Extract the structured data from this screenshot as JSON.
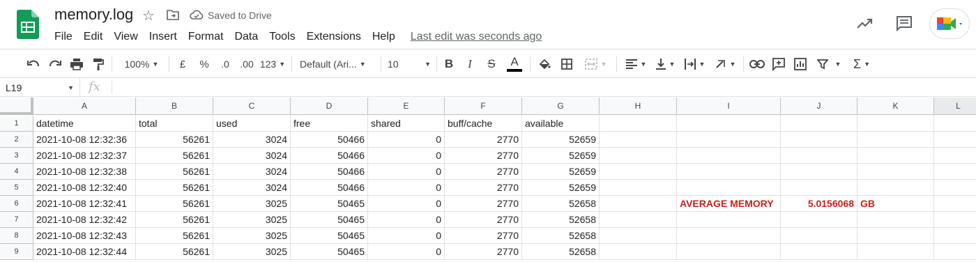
{
  "document": {
    "title": "memory.log",
    "save_status": "Saved to Drive",
    "last_edit": "Last edit was seconds ago"
  },
  "menu": [
    "File",
    "Edit",
    "View",
    "Insert",
    "Format",
    "Data",
    "Tools",
    "Extensions",
    "Help"
  ],
  "toolbar": {
    "zoom": "100%",
    "currency": "£",
    "percent": "%",
    "decrease_decimal": ".0",
    "increase_decimal": ".00",
    "more_formats": "123",
    "font": "Default (Ari...",
    "font_size": "10",
    "bold": "B",
    "italic": "I",
    "strike": "S",
    "text_color_letter": "A",
    "sum": "Σ"
  },
  "formula_bar": {
    "cell_ref": "L19",
    "fx": "fx",
    "value": ""
  },
  "colors": {
    "red_text": "#c5221f",
    "sheets_green": "#0f9d58"
  },
  "grid": {
    "columns": [
      "A",
      "B",
      "C",
      "D",
      "E",
      "F",
      "G",
      "H",
      "I",
      "J",
      "K",
      "L"
    ],
    "rows": [
      {
        "num": "1",
        "cells": [
          "datetime",
          "total",
          "used",
          "free",
          "shared",
          "buff/cache",
          "available",
          "",
          "",
          "",
          ""
        ]
      },
      {
        "num": "2",
        "cells": [
          "2021-10-08 12:32:36",
          "56261",
          "3024",
          "50466",
          "0",
          "2770",
          "52659",
          "",
          "",
          "",
          ""
        ]
      },
      {
        "num": "3",
        "cells": [
          "2021-10-08 12:32:37",
          "56261",
          "3024",
          "50466",
          "0",
          "2770",
          "52659",
          "",
          "",
          "",
          ""
        ]
      },
      {
        "num": "4",
        "cells": [
          "2021-10-08 12:32:38",
          "56261",
          "3024",
          "50466",
          "0",
          "2770",
          "52659",
          "",
          "",
          "",
          ""
        ]
      },
      {
        "num": "5",
        "cells": [
          "2021-10-08 12:32:40",
          "56261",
          "3024",
          "50466",
          "0",
          "2770",
          "52659",
          "",
          "",
          "",
          ""
        ]
      },
      {
        "num": "6",
        "cells": [
          "2021-10-08 12:32:41",
          "56261",
          "3025",
          "50465",
          "0",
          "2770",
          "52658",
          "",
          "AVERAGE MEMORY",
          "5.0156068",
          "GB"
        ]
      },
      {
        "num": "7",
        "cells": [
          "2021-10-08 12:32:42",
          "56261",
          "3025",
          "50465",
          "0",
          "2770",
          "52658",
          "",
          "",
          "",
          ""
        ]
      },
      {
        "num": "8",
        "cells": [
          "2021-10-08 12:32:43",
          "56261",
          "3025",
          "50465",
          "0",
          "2770",
          "52658",
          "",
          "",
          "",
          ""
        ]
      },
      {
        "num": "9",
        "cells": [
          "2021-10-08 12:32:44",
          "56261",
          "3025",
          "50465",
          "0",
          "2770",
          "52658",
          "",
          "",
          "",
          ""
        ]
      }
    ]
  }
}
